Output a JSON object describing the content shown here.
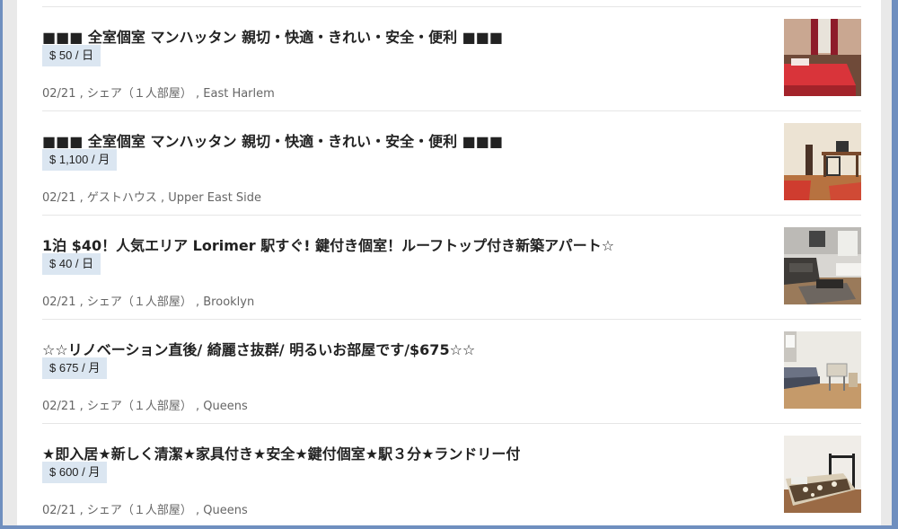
{
  "listings": [
    {
      "title": "■■■ 全室個室 マンハッタン 親切・快適・きれい・安全・便利 ■■■",
      "price": "$ 50 / 日",
      "meta": "02/21 , シェア（１人部屋） , East Harlem",
      "photo": "bedroom-red-bed-photo"
    },
    {
      "title": "■■■ 全室個室 マンハッタン 親切・快適・きれい・安全・便利 ■■■",
      "price": "$ 1,100 / 月",
      "meta": "02/21 , ゲストハウス , Upper East Side",
      "photo": "bedroom-desk-photo"
    },
    {
      "title": "1泊 $40！人気エリア Lorimer 駅すぐ! 鍵付き個室！ルーフトップ付き新築アパート☆",
      "price": "$ 40 / 日",
      "meta": "02/21 , シェア（１人部屋） , Brooklyn",
      "photo": "living-room-sofa-photo"
    },
    {
      "title": "☆☆リノベーション直後/ 綺麗さ抜群/ 明るいお部屋です/$675☆☆",
      "price": "$ 675 / 月",
      "meta": "02/21 , シェア（１人部屋） , Queens",
      "photo": "bright-bedroom-photo"
    },
    {
      "title": "★即入居★新しく清潔★家具付き★安全★鍵付個室★駅３分★ランドリー付",
      "price": "$ 600 / 月",
      "meta": "02/21 , シェア（１人部屋） , Queens",
      "photo": "bed-patterned-blanket-photo"
    }
  ]
}
